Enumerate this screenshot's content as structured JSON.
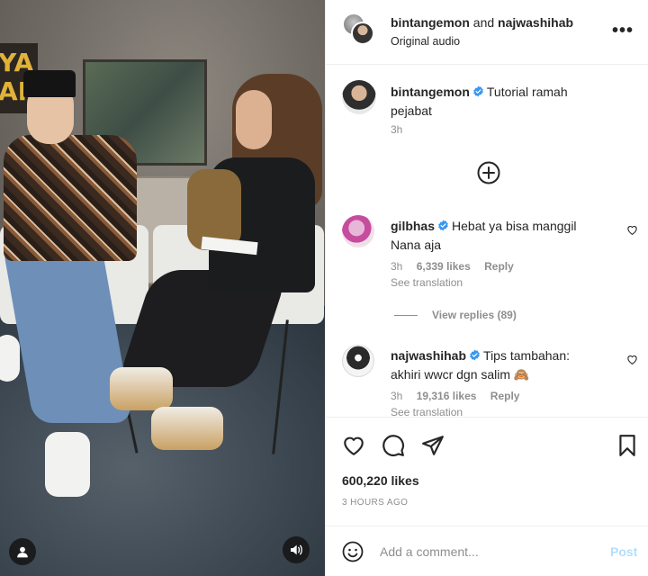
{
  "header": {
    "user1": "bintangemon",
    "and": "and",
    "user2": "najwashihab",
    "subtitle": "Original audio"
  },
  "caption": {
    "username": "bintangemon",
    "text": "Tutorial ramah pejabat",
    "time": "3h"
  },
  "comments": [
    {
      "username": "gilbhas",
      "text": "Hebat ya bisa manggil Nana aja",
      "time": "3h",
      "likes": "6,339 likes",
      "reply": "Reply",
      "see_translation": "See translation",
      "view_replies": "View replies (89)"
    },
    {
      "username": "najwashihab",
      "text": "Tips tambahan: akhiri wwcr dgn salim 🙈",
      "time": "3h",
      "likes": "19,316 likes",
      "reply": "Reply",
      "see_translation": "See translation"
    }
  ],
  "post": {
    "likes": "600,220 likes",
    "ago": "3 HOURS AGO"
  },
  "add_comment": {
    "placeholder": "Add a comment...",
    "post_label": "Post"
  },
  "media_overlay": {
    "sign_text": "YA\nAR"
  },
  "colors": {
    "verified": "#3897f0",
    "post_button": "#b2dffc",
    "secondary_text": "#8e8e8e"
  },
  "icons": [
    "more-icon",
    "verified-icon",
    "load-more-icon",
    "heart-icon",
    "comment-icon",
    "share-icon",
    "save-icon",
    "emoji-icon",
    "user-tag-icon",
    "audio-icon"
  ]
}
